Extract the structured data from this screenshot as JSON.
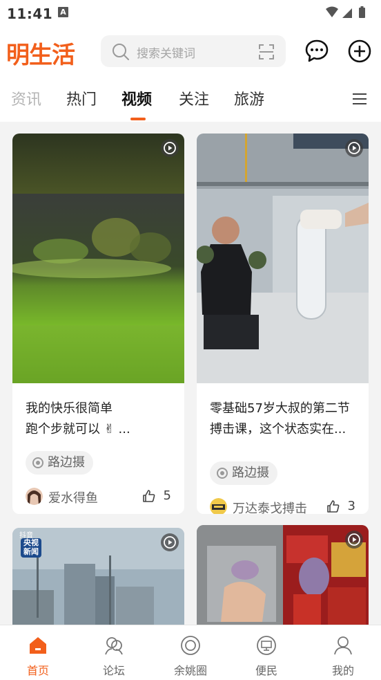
{
  "status_bar": {
    "time": "11:41",
    "notification_badge": "A"
  },
  "header": {
    "logo": "明生活",
    "search_placeholder": "搜索关键词"
  },
  "tabs": [
    {
      "label": "资讯"
    },
    {
      "label": "热门"
    },
    {
      "label": "视频"
    },
    {
      "label": "关注"
    },
    {
      "label": "旅游"
    }
  ],
  "active_tab": "视频",
  "feed": [
    {
      "title_line1": "我的快乐很简单",
      "title_line2": "跑个步就可以 ✌ ...",
      "tag": "路边摄",
      "author": "爱水得鱼",
      "likes": "5"
    },
    {
      "title_line1": "零基础57岁大叔的第二节",
      "title_line2": "搏击课，这个状态实在...",
      "tag": "路边摄",
      "author": "万达泰戈搏击",
      "likes": "3"
    }
  ],
  "partial_cards": [
    {
      "overlay_line1": "抖音",
      "overlay_line2": "央视",
      "overlay_line3": "新闻"
    },
    {}
  ],
  "bottom_nav": [
    {
      "label": "首页"
    },
    {
      "label": "论坛"
    },
    {
      "label": "余姚圈"
    },
    {
      "label": "便民"
    },
    {
      "label": "我的"
    }
  ],
  "colors": {
    "accent": "#f25f1b",
    "text": "#222222",
    "muted": "#999999"
  }
}
